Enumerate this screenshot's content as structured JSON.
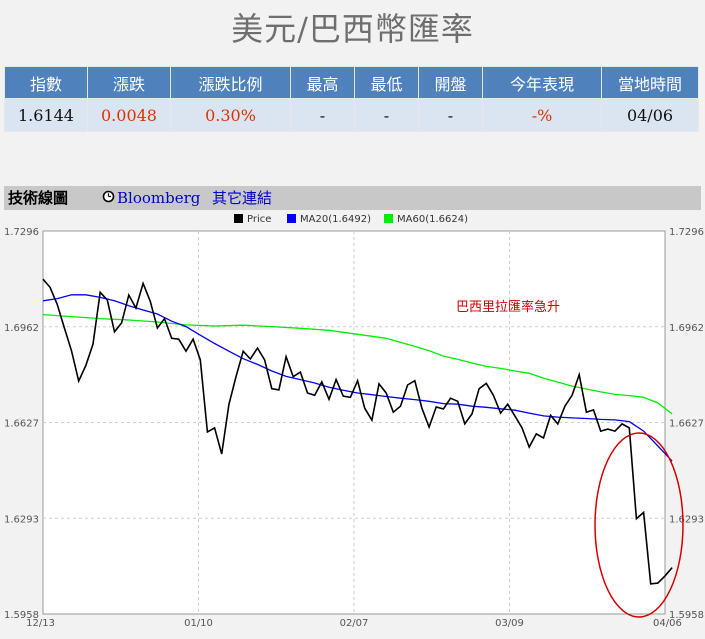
{
  "page": {
    "title": "美元/巴西幣匯率"
  },
  "quote_table": {
    "headers": [
      "指數",
      "漲跌",
      "漲跌比例",
      "最高",
      "最低",
      "開盤",
      "今年表現",
      "當地時間"
    ],
    "row": [
      "1.6144",
      "0.0048",
      "0.30%",
      "-",
      "-",
      "-",
      "-%",
      "04/06"
    ]
  },
  "section": {
    "label": "技術線圖",
    "source_link": "Bloomberg",
    "other_link": "其它連結"
  },
  "colors": {
    "price": "#000000",
    "ma20": "#0000ff",
    "ma60": "#00ee00",
    "annotation": "#cc0000",
    "header_bg": "#4f81bd",
    "row_bg": "#dbe5f1"
  },
  "chart_data": {
    "type": "line",
    "ylim": [
      1.5958,
      1.7296
    ],
    "yticks": [
      "1.7296",
      "1.6962",
      "1.6627",
      "1.6293",
      "1.5958"
    ],
    "xticks": [
      "12/13",
      "01/10",
      "02/07",
      "03/09",
      "04/06"
    ],
    "legend": [
      {
        "name": "Price",
        "color": "#000000"
      },
      {
        "name": "MA20(1.6492)",
        "color": "#0000ff"
      },
      {
        "name": "MA60(1.6624)",
        "color": "#00ee00"
      }
    ],
    "annotation": "巴西里拉匯率急升",
    "grid": true,
    "x_count": 87,
    "series": [
      {
        "name": "Price",
        "color": "#000000",
        "values": [
          [
            0,
            1.7128
          ],
          [
            1,
            1.7099
          ],
          [
            2,
            1.7039
          ],
          [
            3,
            1.6957
          ],
          [
            4,
            1.6876
          ],
          [
            5,
            1.6772
          ],
          [
            6,
            1.6827
          ],
          [
            7,
            1.6901
          ],
          [
            8,
            1.7082
          ],
          [
            9,
            1.7055
          ],
          [
            10,
            1.6944
          ],
          [
            11,
            1.6975
          ],
          [
            12,
            1.7072
          ],
          [
            13,
            1.7027
          ],
          [
            14,
            1.7113
          ],
          [
            15,
            1.7051
          ],
          [
            16,
            1.6957
          ],
          [
            17,
            1.699
          ],
          [
            18,
            1.6921
          ],
          [
            19,
            1.6918
          ],
          [
            20,
            1.6876
          ],
          [
            21,
            1.6918
          ],
          [
            22,
            1.6846
          ],
          [
            23,
            1.6594
          ],
          [
            24,
            1.6608
          ],
          [
            25,
            1.6517
          ],
          [
            26,
            1.669
          ],
          [
            27,
            1.6787
          ],
          [
            28,
            1.6876
          ],
          [
            29,
            1.6849
          ],
          [
            30,
            1.6887
          ],
          [
            31,
            1.6846
          ],
          [
            32,
            1.6745
          ],
          [
            33,
            1.6741
          ],
          [
            34,
            1.6857
          ],
          [
            35,
            1.6787
          ],
          [
            36,
            1.6803
          ],
          [
            37,
            1.673
          ],
          [
            38,
            1.6722
          ],
          [
            39,
            1.6769
          ],
          [
            40,
            1.6708
          ],
          [
            41,
            1.6777
          ],
          [
            42,
            1.6719
          ],
          [
            43,
            1.6715
          ],
          [
            44,
            1.6773
          ],
          [
            45,
            1.6677
          ],
          [
            46,
            1.6635
          ],
          [
            47,
            1.6762
          ],
          [
            48,
            1.673
          ],
          [
            49,
            1.6663
          ],
          [
            50,
            1.6684
          ],
          [
            51,
            1.6758
          ],
          [
            52,
            1.6773
          ],
          [
            53,
            1.6677
          ],
          [
            54,
            1.6611
          ],
          [
            55,
            1.6681
          ],
          [
            56,
            1.6674
          ],
          [
            57,
            1.6712
          ],
          [
            58,
            1.6701
          ],
          [
            59,
            1.6622
          ],
          [
            60,
            1.6657
          ],
          [
            61,
            1.6745
          ],
          [
            62,
            1.6764
          ],
          [
            63,
            1.6722
          ],
          [
            64,
            1.666
          ],
          [
            65,
            1.6691
          ],
          [
            66,
            1.665
          ],
          [
            67,
            1.6608
          ],
          [
            68,
            1.6541
          ],
          [
            69,
            1.6587
          ],
          [
            70,
            1.6573
          ],
          [
            71,
            1.6652
          ],
          [
            72,
            1.6622
          ],
          [
            73,
            1.6684
          ],
          [
            74,
            1.6722
          ],
          [
            75,
            1.6794
          ],
          [
            76,
            1.6663
          ],
          [
            77,
            1.6671
          ],
          [
            78,
            1.6597
          ],
          [
            79,
            1.6604
          ],
          [
            80,
            1.6597
          ],
          [
            81,
            1.6622
          ],
          [
            82,
            1.6608
          ],
          [
            83,
            1.6291
          ],
          [
            84,
            1.6313
          ],
          [
            85,
            1.6063
          ],
          [
            86,
            1.6066
          ],
          [
            87,
            1.6091
          ],
          [
            88,
            1.612
          ]
        ]
      },
      {
        "name": "MA20",
        "color": "#0000ff",
        "values": [
          [
            0,
            1.7052
          ],
          [
            2,
            1.706
          ],
          [
            4,
            1.7073
          ],
          [
            6,
            1.7073
          ],
          [
            8,
            1.7064
          ],
          [
            10,
            1.7052
          ],
          [
            12,
            1.7035
          ],
          [
            14,
            1.702
          ],
          [
            16,
            1.7006
          ],
          [
            18,
            1.6981
          ],
          [
            20,
            1.6962
          ],
          [
            22,
            1.6932
          ],
          [
            24,
            1.6903
          ],
          [
            26,
            1.6876
          ],
          [
            28,
            1.685
          ],
          [
            30,
            1.683
          ],
          [
            32,
            1.6807
          ],
          [
            34,
            1.6788
          ],
          [
            36,
            1.6777
          ],
          [
            38,
            1.6765
          ],
          [
            40,
            1.675
          ],
          [
            42,
            1.674
          ],
          [
            44,
            1.673
          ],
          [
            46,
            1.6724
          ],
          [
            48,
            1.6718
          ],
          [
            50,
            1.6712
          ],
          [
            52,
            1.6707
          ],
          [
            54,
            1.6701
          ],
          [
            56,
            1.6693
          ],
          [
            58,
            1.6691
          ],
          [
            60,
            1.6684
          ],
          [
            62,
            1.668
          ],
          [
            64,
            1.6675
          ],
          [
            66,
            1.667
          ],
          [
            68,
            1.666
          ],
          [
            70,
            1.665
          ],
          [
            72,
            1.6646
          ],
          [
            74,
            1.6643
          ],
          [
            76,
            1.6641
          ],
          [
            78,
            1.6638
          ],
          [
            80,
            1.6636
          ],
          [
            82,
            1.663
          ],
          [
            84,
            1.6597
          ],
          [
            86,
            1.6545
          ],
          [
            88,
            1.6492
          ]
        ]
      },
      {
        "name": "MA60",
        "color": "#00ee00",
        "values": [
          [
            0,
            1.7004
          ],
          [
            4,
            1.6997
          ],
          [
            8,
            1.699
          ],
          [
            12,
            1.6985
          ],
          [
            16,
            1.6978
          ],
          [
            20,
            1.6968
          ],
          [
            24,
            1.6964
          ],
          [
            28,
            1.6967
          ],
          [
            32,
            1.6962
          ],
          [
            36,
            1.6956
          ],
          [
            40,
            1.6949
          ],
          [
            44,
            1.6935
          ],
          [
            48,
            1.6921
          ],
          [
            52,
            1.6893
          ],
          [
            54,
            1.6878
          ],
          [
            56,
            1.6859
          ],
          [
            58,
            1.6848
          ],
          [
            60,
            1.6835
          ],
          [
            62,
            1.6823
          ],
          [
            64,
            1.6816
          ],
          [
            66,
            1.6807
          ],
          [
            68,
            1.6799
          ],
          [
            70,
            1.6782
          ],
          [
            72,
            1.6768
          ],
          [
            74,
            1.6754
          ],
          [
            76,
            1.6744
          ],
          [
            78,
            1.6734
          ],
          [
            80,
            1.6725
          ],
          [
            82,
            1.6721
          ],
          [
            84,
            1.6715
          ],
          [
            86,
            1.6695
          ],
          [
            88,
            1.6657
          ]
        ]
      }
    ]
  }
}
